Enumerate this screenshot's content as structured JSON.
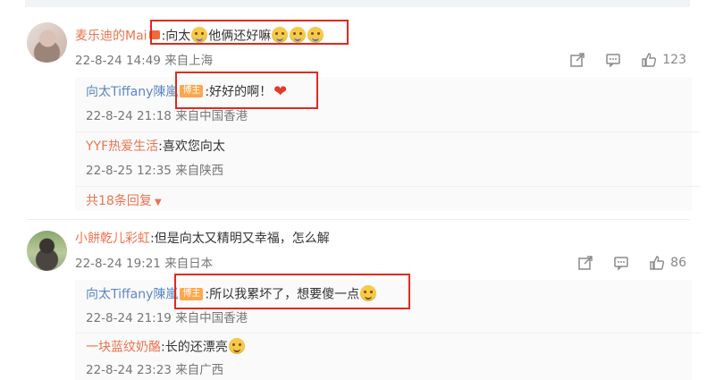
{
  "comments": [
    {
      "username": "麦乐迪的Mai",
      "text": ":向太",
      "text_after": "他俩还好嘛",
      "time": "22-8-24 14:49",
      "location": "来自上海",
      "likes": "123",
      "replies": [
        {
          "username": "向太Tiffany陳嵐",
          "badge": "博主",
          "text": ":好好的啊！",
          "time": "22-8-24 21:18",
          "location": "来自中国香港"
        },
        {
          "username": "YYF热爱生活",
          "text": ":喜欢您向太",
          "time": "22-8-25 12:35",
          "location": "来自陕西"
        }
      ],
      "more_replies": "共18条回复"
    },
    {
      "username": "小餅乾儿彩虹",
      "text": ":但是向太又精明又幸福，怎么解",
      "time": "22-8-24 19:21",
      "location": "来自日本",
      "likes": "86",
      "replies": [
        {
          "username": "向太Tiffany陳嵐",
          "badge": "博主",
          "text": ":所以我累坏了，想要傻一点",
          "time": "22-8-24 21:19",
          "location": "来自中国香港"
        },
        {
          "username": "一块蓝纹奶酪",
          "text": ":长的还漂亮",
          "time": "22-8-24 23:23",
          "location": "来自广西"
        }
      ]
    }
  ],
  "colors": {
    "username": "#eb7350",
    "highlight": "#e1291f",
    "badge": "#ffa64d"
  },
  "icons": [
    "share-icon",
    "comment-icon",
    "like-icon",
    "emoji-icon",
    "heart-icon"
  ]
}
